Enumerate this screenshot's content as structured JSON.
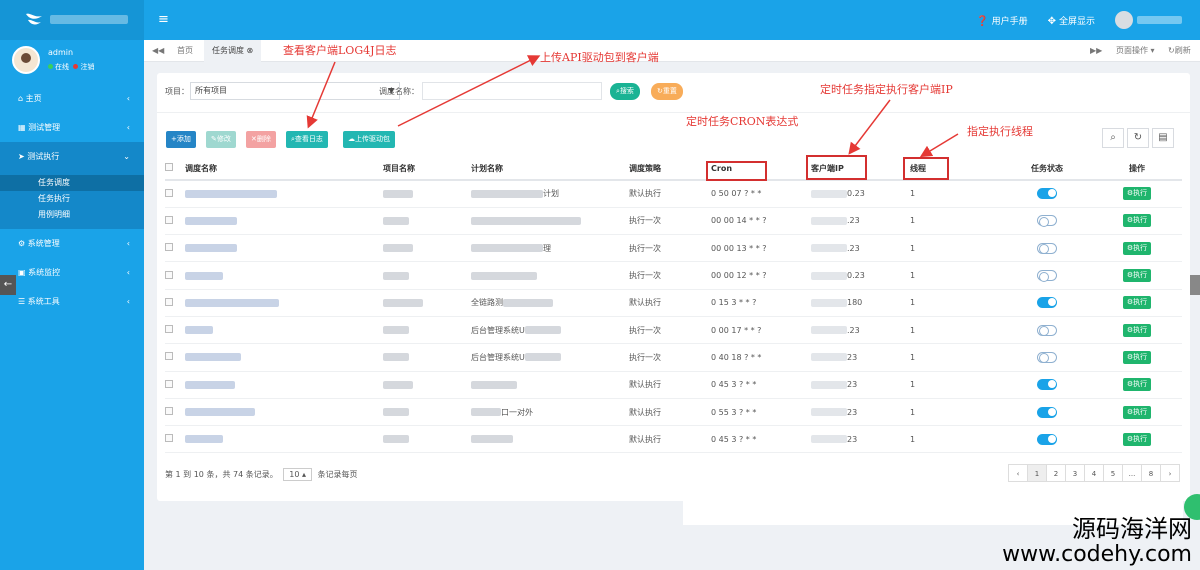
{
  "header": {
    "menu_icon": "≡",
    "user_manual": "用户手册",
    "fullscreen": "全屏显示"
  },
  "sidebar": {
    "username": "admin",
    "status_online": "在线",
    "status_logout": "注销",
    "items": [
      {
        "label": "主页"
      },
      {
        "label": "测试管理"
      },
      {
        "label": "测试执行"
      },
      {
        "label": "系统管理"
      },
      {
        "label": "系统监控"
      },
      {
        "label": "系统工具"
      }
    ],
    "subitems": [
      {
        "label": "任务调度"
      },
      {
        "label": "任务执行"
      },
      {
        "label": "用例明细"
      }
    ]
  },
  "tabs": {
    "home": "首页",
    "current": "任务调度",
    "page_ops": "页面操作",
    "refresh": "刷新"
  },
  "search": {
    "project_label": "项目：",
    "project_value": "所有项目",
    "schedule_label": "调度名称：",
    "search_btn": "搜索",
    "reset_btn": "重置"
  },
  "toolbar": {
    "add": "添加",
    "edit": "修改",
    "delete": "删除",
    "view_log": "查看日志",
    "upload_driver": "上传驱动包"
  },
  "columns": [
    "调度名称",
    "项目名称",
    "计划名称",
    "调度策略",
    "Cron",
    "客户端IP",
    "线程",
    "任务状态",
    "操作"
  ],
  "rows": [
    {
      "plan": "计划",
      "strategy": "默认执行",
      "cron": "0 50 07 ? * *",
      "ip": "0.23",
      "thread": "1",
      "on": true
    },
    {
      "plan": "",
      "strategy": "执行一次",
      "cron": "00 00 14 * * ?",
      "ip": ".23",
      "thread": "1",
      "on": false
    },
    {
      "plan": "理",
      "strategy": "执行一次",
      "cron": "00 00 13 * * ?",
      "ip": ".23",
      "thread": "1",
      "on": false
    },
    {
      "plan": "",
      "strategy": "执行一次",
      "cron": "00 00 12 * * ?",
      "ip": "0.23",
      "thread": "1",
      "on": false
    },
    {
      "plan": "全链路测",
      "strategy": "默认执行",
      "cron": "0 15 3 * * ?",
      "ip": "180",
      "thread": "1",
      "on": true
    },
    {
      "plan": "后台管理系统U",
      "strategy": "执行一次",
      "cron": "0 00 17 * * ?",
      "ip": ".23",
      "thread": "1",
      "on": false
    },
    {
      "plan": "后台管理系统U",
      "strategy": "执行一次",
      "cron": "0 40 18 ? * *",
      "ip": "23",
      "thread": "1",
      "on": false
    },
    {
      "plan": "",
      "strategy": "默认执行",
      "cron": "0 45 3 ? * *",
      "ip": "23",
      "thread": "1",
      "on": true
    },
    {
      "plan": "口一对外",
      "strategy": "默认执行",
      "cron": "0 55 3 ? * *",
      "ip": "23",
      "thread": "1",
      "on": true
    },
    {
      "plan": "",
      "strategy": "默认执行",
      "cron": "0 45 3 ? * *",
      "ip": "23",
      "thread": "1",
      "on": true
    }
  ],
  "exec_label": "执行",
  "footer": {
    "info_prefix": "第 1 到 10 条，共 74 条记录。",
    "page_size": "10",
    "info_suffix": "条记录每页"
  },
  "pager": [
    "‹",
    "1",
    "2",
    "3",
    "4",
    "5",
    "...",
    "8",
    "›"
  ],
  "annotations": {
    "log4j": "查看客户端LOG4J日志",
    "upload_api": "上传API驱动包到客户端",
    "client_ip": "定时任务指定执行客户端IP",
    "cron_expr": "定时任务CRON表达式",
    "thread": "指定执行线程"
  },
  "watermark": {
    "line1": "源码海洋网",
    "line2": "www.codehy.com"
  }
}
